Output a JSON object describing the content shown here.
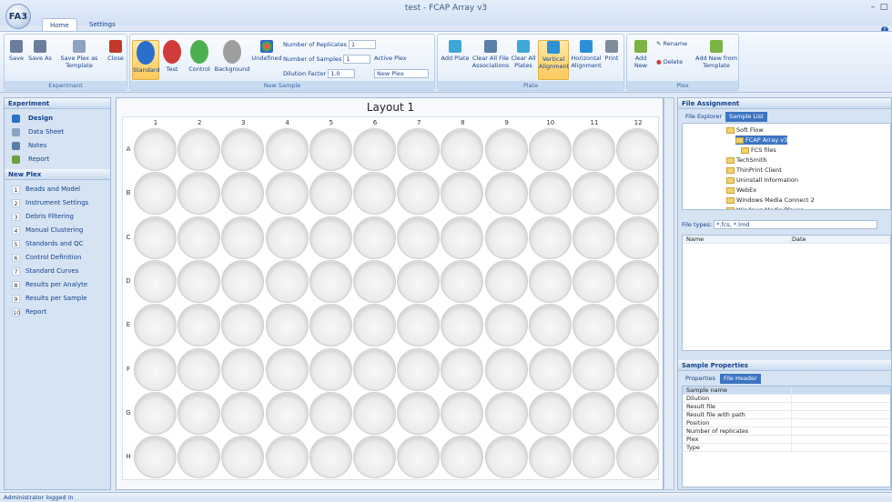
{
  "window": {
    "title": "test - FCAP Array v3",
    "logo": "FA3"
  },
  "tabs": {
    "home": "Home",
    "settings": "Settings"
  },
  "ribbon": {
    "experiment": {
      "label": "Experiment",
      "save": "Save",
      "save_as": "Save As",
      "save_plex": "Save Plex as Template",
      "close": "Close"
    },
    "new_sample": {
      "label": "New Sample",
      "standard": "Standard",
      "test": "Test",
      "control": "Control",
      "background": "Background",
      "undefined": "Undefined",
      "replicates_label": "Number of Replicates",
      "replicates_value": "1",
      "samples_label": "Number of Samples",
      "samples_value": "1",
      "dilution_label": "Dilution Factor",
      "dilution_value": "1.0",
      "active_plex_label": "Active Plex",
      "active_plex_value": "New Plex"
    },
    "plate": {
      "label": "Plate",
      "add_plate": "Add Plate",
      "clear_file": "Clear All File Associations",
      "clear_plates": "Clear All Plates",
      "vertical": "Vertical Alignment",
      "horizontal": "Horizontal Alignment",
      "print": "Print"
    },
    "plex": {
      "label": "Plex",
      "add_new": "Add New",
      "rename": "Rename",
      "delete": "Delete",
      "add_template": "Add New from Template"
    }
  },
  "left": {
    "experiment_header": "Experiment",
    "experiment_items": [
      "Design",
      "Data Sheet",
      "Notes",
      "Report"
    ],
    "plex_header": "New Plex",
    "plex_items": [
      {
        "n": "1",
        "label": "Beads and Model"
      },
      {
        "n": "2",
        "label": "Instrument Settings"
      },
      {
        "n": "3",
        "label": "Debris Filtering"
      },
      {
        "n": "4",
        "label": "Manual Clustering"
      },
      {
        "n": "5",
        "label": "Standards and QC"
      },
      {
        "n": "6",
        "label": "Control Definition"
      },
      {
        "n": "7",
        "label": "Standard Curves"
      },
      {
        "n": "8",
        "label": "Results per Analyte"
      },
      {
        "n": "9",
        "label": "Results per Sample"
      },
      {
        "n": "10",
        "label": "Report"
      }
    ]
  },
  "layout": {
    "title": "Layout 1",
    "columns": [
      "1",
      "2",
      "3",
      "4",
      "5",
      "6",
      "7",
      "8",
      "9",
      "10",
      "11",
      "12"
    ],
    "rows": [
      "A",
      "B",
      "C",
      "D",
      "E",
      "F",
      "G",
      "H"
    ]
  },
  "right": {
    "file_assignment": "File Assignment",
    "subtabs": [
      "File Explorer",
      "Sample List"
    ],
    "tree": [
      "Soft Flow",
      "FCAP Array v3",
      "FCS files",
      "TechSmith",
      "ThinPrint Client",
      "Uninstall Information",
      "WebEx",
      "Windows Media Connect 2",
      "Windows Media Player"
    ],
    "file_types_label": "File types:",
    "file_types_value": "*.fcs, *.lmd",
    "list_cols": [
      "Name",
      "Date"
    ],
    "sample_props": "Sample Properties",
    "prop_tabs": [
      "Properties",
      "File Header"
    ],
    "props": [
      "Sample name",
      "Dilution",
      "Result file",
      "Result file with path",
      "Position",
      "Number of replicates",
      "Plex",
      "Type"
    ]
  },
  "status": "Administrator logged in"
}
